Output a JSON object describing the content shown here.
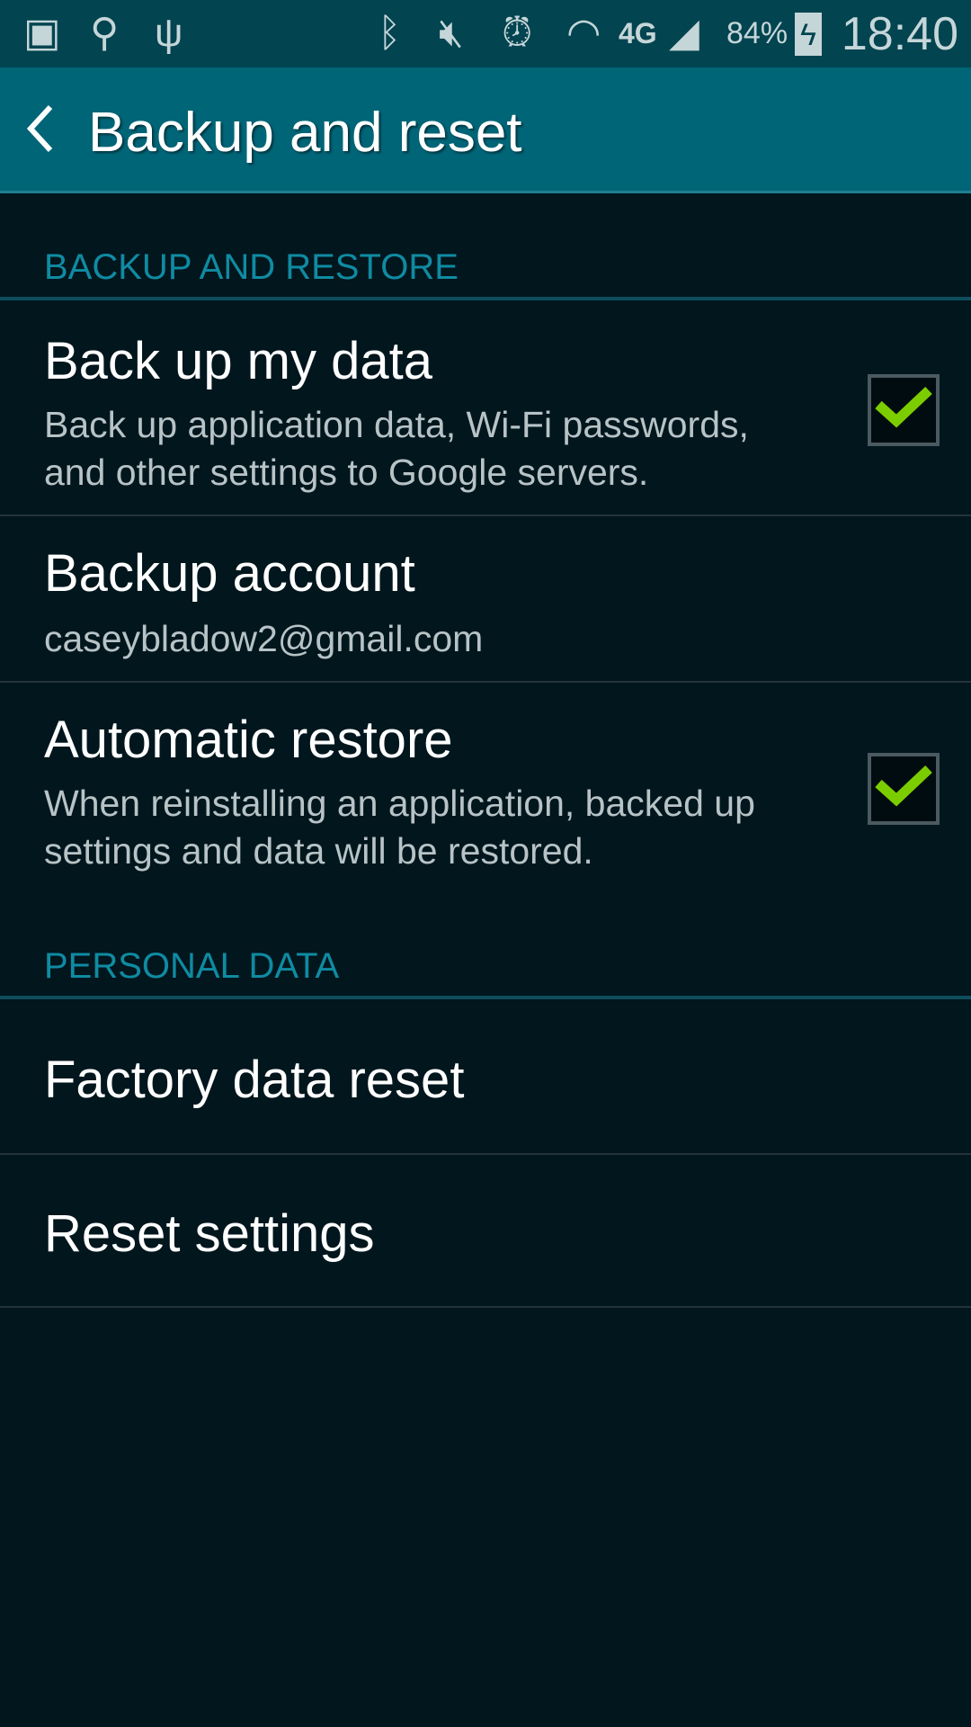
{
  "status_bar": {
    "left_icons": [
      "facebook-icon",
      "location-icon",
      "usb-icon"
    ],
    "right_icons": [
      "bluetooth-icon",
      "mute-icon",
      "alarm-icon",
      "wifi-icon",
      "4g-lte-icon",
      "signal-icon"
    ],
    "battery": "84%",
    "time": "18:40"
  },
  "app_bar": {
    "title": "Backup and reset"
  },
  "sections": [
    {
      "header": "BACKUP AND RESTORE"
    },
    {
      "header": "PERSONAL DATA"
    }
  ],
  "items": [
    {
      "title": "Back up my data",
      "subtitle_1": "Back up application data, Wi-Fi passwords,",
      "subtitle_2": "and other settings to Google servers.",
      "checked": true
    },
    {
      "title": "Backup account",
      "subtitle": "caseybladow2@gmail.com"
    },
    {
      "title": "Automatic restore",
      "subtitle_1": "When reinstalling an application, backed up",
      "subtitle_2": "settings and data will be restored.",
      "checked": true
    },
    {
      "title": "Factory data reset"
    },
    {
      "title": "Reset settings"
    }
  ],
  "colors": {
    "check": "#7ccd00",
    "accent": "#0f8ba2",
    "app_bar": "#006577"
  }
}
